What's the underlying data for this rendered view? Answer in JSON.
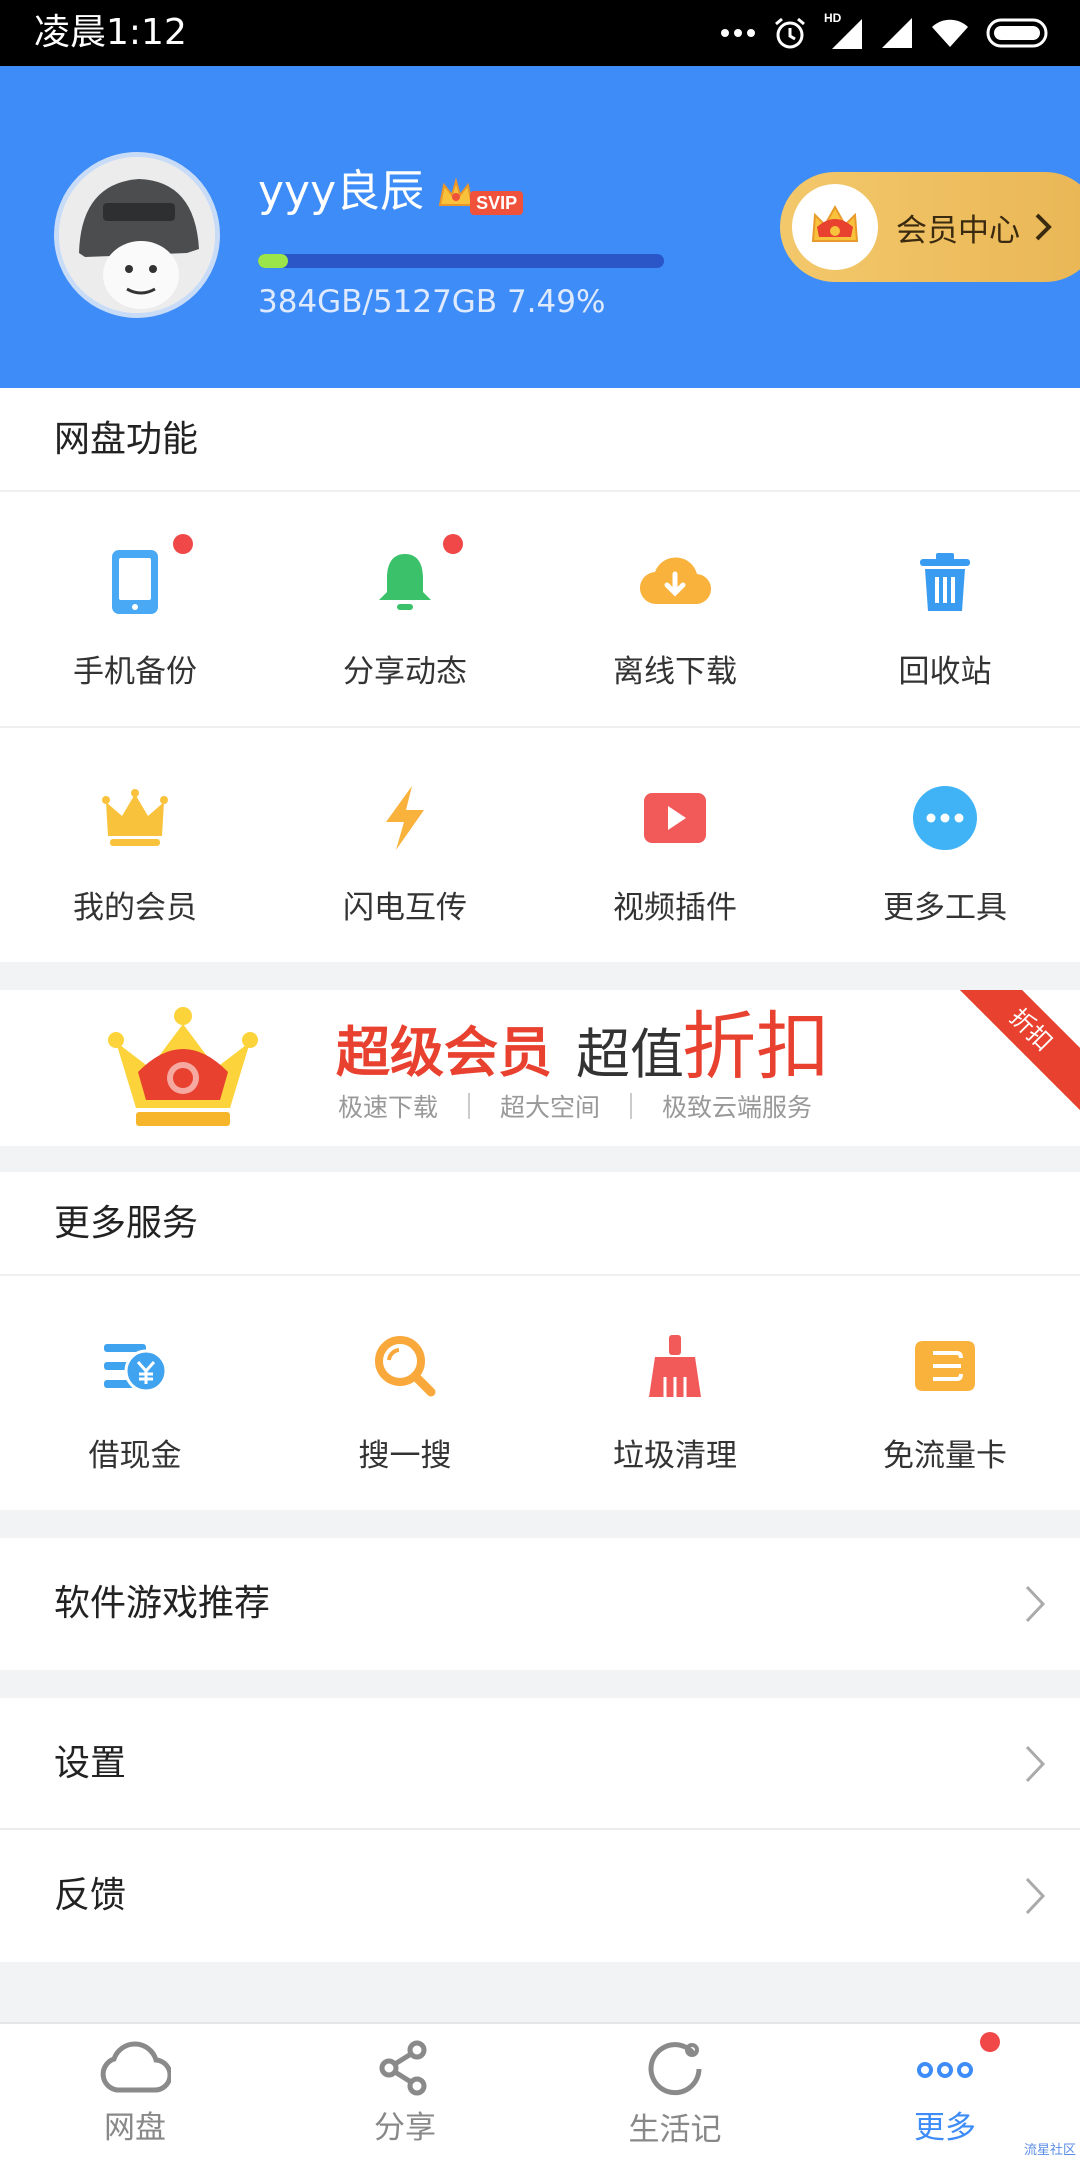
{
  "status_bar": {
    "time": "凌晨1:12",
    "network_label": "HD"
  },
  "header": {
    "username": "yyy良辰",
    "badge": "SVIP",
    "quota_text": "384GB/5127GB 7.49%",
    "quota_fraction": 0.0749,
    "vip_center_label": "会员中心"
  },
  "features": {
    "title": "网盘功能",
    "rows": [
      [
        {
          "label": "手机备份",
          "icon": "phone-icon",
          "color": "#4aa9f5",
          "dot": true
        },
        {
          "label": "分享动态",
          "icon": "bell-icon",
          "color": "#3cc16b",
          "dot": true
        },
        {
          "label": "离线下载",
          "icon": "cloud-download-icon",
          "color": "#f9b23c",
          "dot": false
        },
        {
          "label": "回收站",
          "icon": "trash-icon",
          "color": "#3a9cf0",
          "dot": false
        }
      ],
      [
        {
          "label": "我的会员",
          "icon": "crown-icon",
          "color": "#f9c23c",
          "dot": false
        },
        {
          "label": "闪电互传",
          "icon": "lightning-icon",
          "color": "#f9b23c",
          "dot": false
        },
        {
          "label": "视频插件",
          "icon": "video-play-icon",
          "color": "#f25a5a",
          "dot": false
        },
        {
          "label": "更多工具",
          "icon": "more-dots-icon",
          "color": "#3fb3f5",
          "dot": false
        }
      ]
    ]
  },
  "banner": {
    "title_bold": "超级会员",
    "title_normal": "超值",
    "title_big": "折扣",
    "subtitles": [
      "极速下载",
      "超大空间",
      "极致云端服务"
    ],
    "ribbon": "折扣"
  },
  "services": {
    "title": "更多服务",
    "items": [
      {
        "label": "借现金",
        "icon": "cash-icon",
        "color": "#3fa3f0"
      },
      {
        "label": "搜一搜",
        "icon": "search-icon",
        "color": "#f9a83c"
      },
      {
        "label": "垃圾清理",
        "icon": "broom-icon",
        "color": "#f25a5a"
      },
      {
        "label": "免流量卡",
        "icon": "sim-card-icon",
        "color": "#f9b23c"
      }
    ]
  },
  "menu": {
    "recommend": "软件游戏推荐",
    "settings": "设置",
    "feedback": "反馈"
  },
  "tabs": [
    {
      "label": "网盘",
      "icon": "cloud-icon",
      "active": false
    },
    {
      "label": "分享",
      "icon": "share-icon",
      "active": false
    },
    {
      "label": "生活记",
      "icon": "refresh-circle-icon",
      "active": false
    },
    {
      "label": "更多",
      "icon": "more-icon",
      "active": true,
      "dot": true
    }
  ],
  "watermark": "流星社区"
}
